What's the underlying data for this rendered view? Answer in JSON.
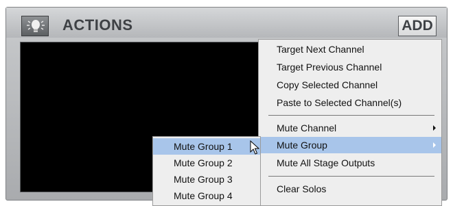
{
  "panel": {
    "title": "ACTIONS",
    "bulb_icon": "lightbulb-icon",
    "add_label": "ADD"
  },
  "menu": {
    "items": [
      {
        "label": "Target Next Channel"
      },
      {
        "label": "Target Previous Channel"
      },
      {
        "label": "Copy Selected Channel"
      },
      {
        "label": "Paste to Selected Channel(s)"
      },
      {
        "label": "Mute Channel",
        "submenu": true
      },
      {
        "label": "Mute Group",
        "submenu": true,
        "highlighted": true
      },
      {
        "label": "Mute All Stage Outputs"
      },
      {
        "label": "Clear Solos"
      }
    ]
  },
  "submenu": {
    "items": [
      {
        "label": "Mute Group 1",
        "highlighted": true
      },
      {
        "label": "Mute Group 2"
      },
      {
        "label": "Mute Group 3"
      },
      {
        "label": "Mute Group 4"
      }
    ]
  },
  "colors": {
    "highlight": "#a8c5ea",
    "menu_bg": "#eeeeee",
    "display_bg": "#000000"
  },
  "cursor_icon": "arrow-pointer-icon"
}
